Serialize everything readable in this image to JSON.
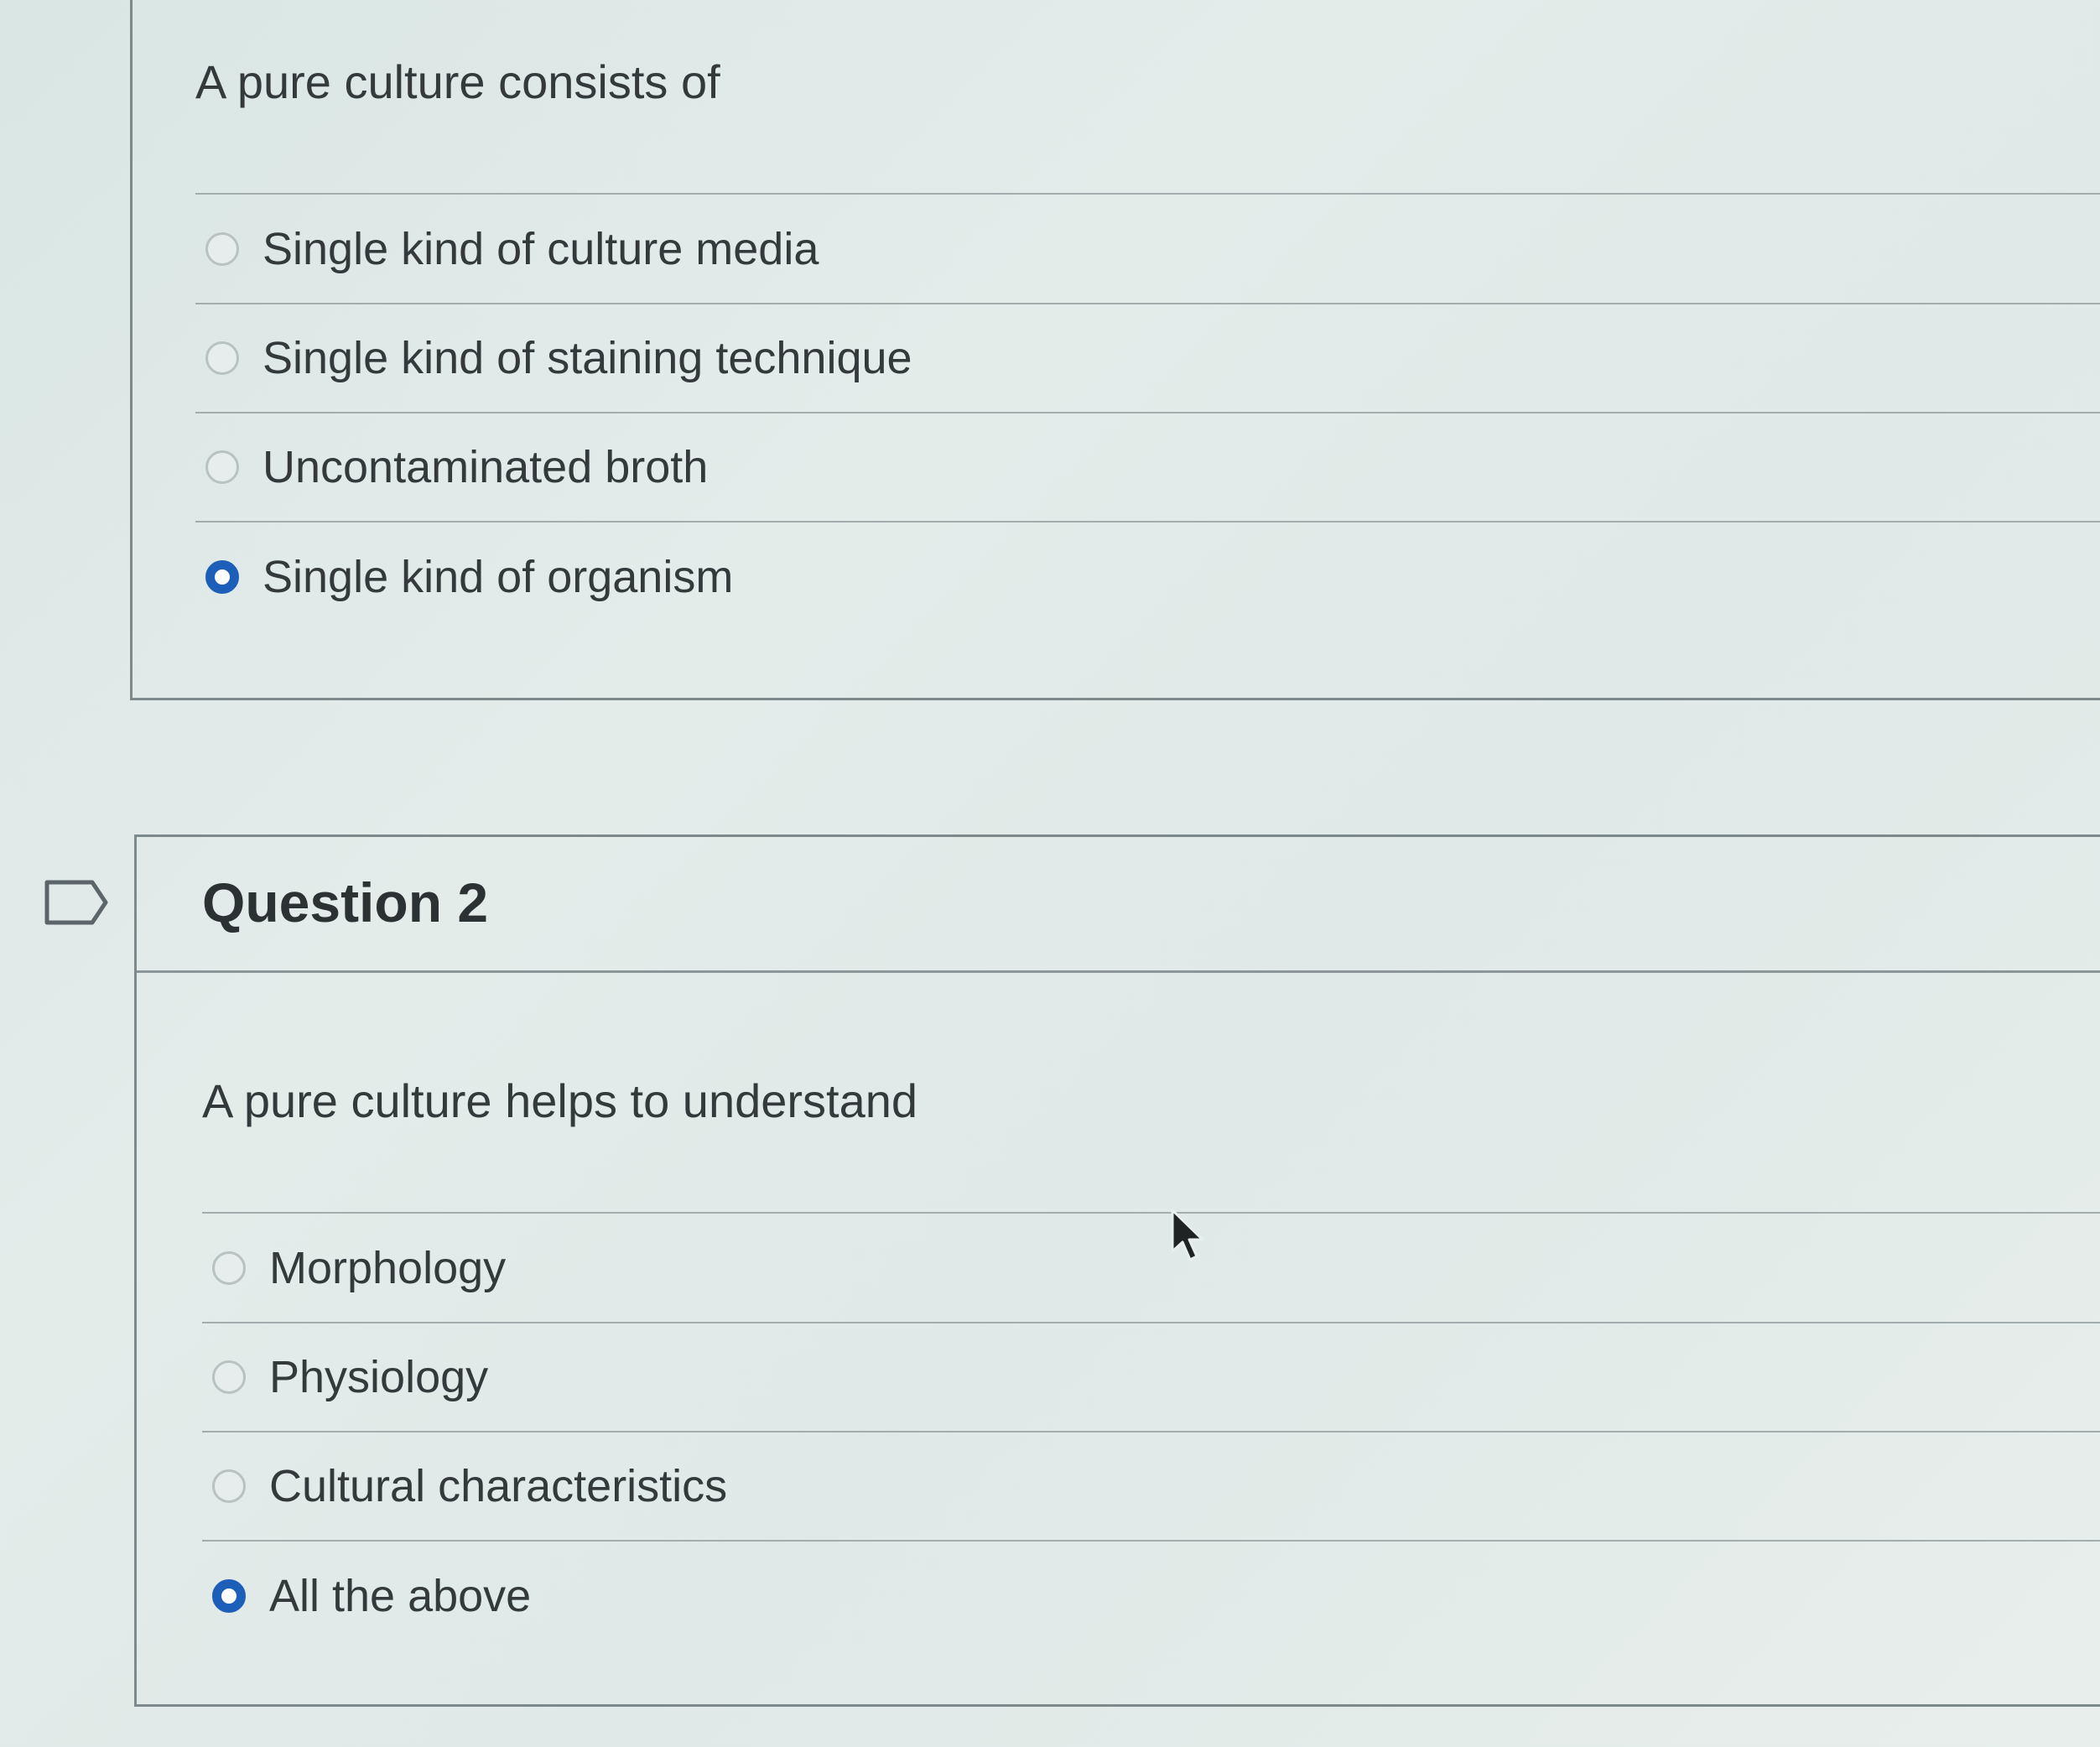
{
  "question_1": {
    "text": "A pure culture consists of",
    "answers": [
      {
        "label": "Single kind of culture media",
        "selected": false
      },
      {
        "label": "Single kind of staining technique",
        "selected": false
      },
      {
        "label": "Uncontaminated broth",
        "selected": false
      },
      {
        "label": "Single kind of organism",
        "selected": true
      }
    ]
  },
  "question_2": {
    "title": "Question 2",
    "text": "A pure culture helps to understand",
    "answers": [
      {
        "label": "Morphology",
        "selected": false
      },
      {
        "label": "Physiology",
        "selected": false
      },
      {
        "label": "Cultural characteristics",
        "selected": false
      },
      {
        "label": "All the above",
        "selected": true
      }
    ]
  },
  "colors": {
    "accent": "#1d5fb8",
    "text": "#34393c",
    "border": "#7d8a8c"
  },
  "icons": {
    "flag": "flag-icon",
    "cursor": "mouse-pointer-icon"
  }
}
